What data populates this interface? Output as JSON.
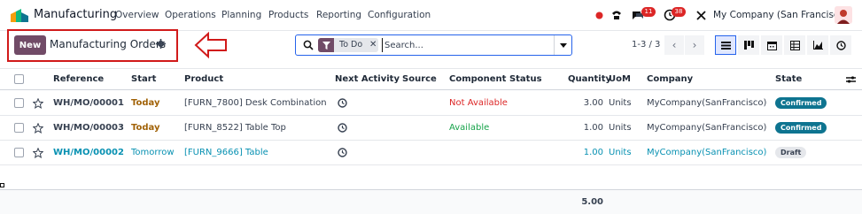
{
  "app": {
    "name": "Manufacturing"
  },
  "menu": [
    "Overview",
    "Operations",
    "Planning",
    "Products",
    "Reporting",
    "Configuration"
  ],
  "systray": {
    "messages_count": "11",
    "activities_count": "38",
    "company": "My Company (San Francisco)"
  },
  "control_panel": {
    "new_label": "New",
    "title": "Manufacturing Orders",
    "search": {
      "facet_label": "To Do",
      "placeholder": "Search..."
    },
    "pager": "1-3 / 3",
    "views": [
      "list",
      "kanban",
      "calendar",
      "pivot",
      "graph",
      "activity"
    ]
  },
  "table": {
    "columns": [
      "Reference",
      "Start",
      "Product",
      "Next Activity",
      "Source",
      "Component Status",
      "Quantity",
      "UoM",
      "Company",
      "State"
    ],
    "rows": [
      {
        "reference": "WH/MO/00001",
        "start": "Today",
        "product": "[FURN_7800] Desk Combination",
        "source": "",
        "component_status": "Not Available",
        "quantity": "3.00",
        "uom": "Units",
        "company": "MyCompany(SanFrancisco)",
        "state": "Confirmed"
      },
      {
        "reference": "WH/MO/00003",
        "start": "Today",
        "product": "[FURN_8522] Table Top",
        "source": "",
        "component_status": "Available",
        "quantity": "1.00",
        "uom": "Units",
        "company": "MyCompany(SanFrancisco)",
        "state": "Confirmed"
      },
      {
        "reference": "WH/MO/00002",
        "start": "Tomorrow",
        "product": "[FURN_9666] Table",
        "source": "",
        "component_status": "",
        "quantity": "1.00",
        "uom": "Units",
        "company": "MyCompany(SanFrancisco)",
        "state": "Draft"
      }
    ],
    "total_quantity": "5.00"
  },
  "colors": {
    "brand": "#714b67",
    "accent": "#2563eb",
    "annotation": "#d11a1a"
  }
}
